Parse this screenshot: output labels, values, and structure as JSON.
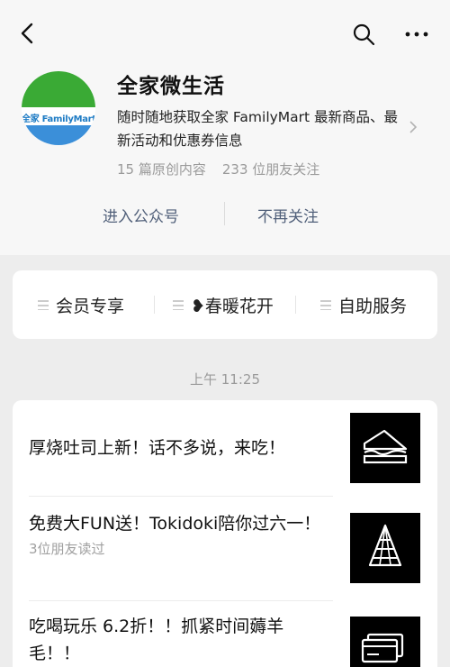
{
  "account": {
    "name": "全家微生活",
    "logo_text": "全家 FamilyMart",
    "description": "随时随地获取全家 FamilyMart 最新商品、最新活动和优惠券信息",
    "original_count": "15 篇原创内容",
    "friends_following": "233 位朋友关注",
    "enter_label": "进入公众号",
    "unfollow_label": "不再关注"
  },
  "menu": [
    {
      "label": "会员专享"
    },
    {
      "label": "❥春暖花开"
    },
    {
      "label": "自助服务"
    }
  ],
  "feed": {
    "timestamp": "上午 11:25",
    "articles": [
      {
        "title": "厚烧吐司上新！话不多说，来吃！",
        "meta": "",
        "icon": "sandwich-icon"
      },
      {
        "title": "免费大FUN送！Tokidoki陪你过六一！",
        "meta": "3位朋友读过",
        "icon": "cone-icon"
      },
      {
        "title": "吃喝玩乐 6.2折！！抓紧时间薅羊毛！！",
        "meta": "",
        "icon": "card-icon"
      }
    ]
  },
  "colors": {
    "link": "#51607a",
    "muted": "#9a9a9a",
    "logo_green": "#3aaa35",
    "logo_blue": "#3b8fd9"
  }
}
